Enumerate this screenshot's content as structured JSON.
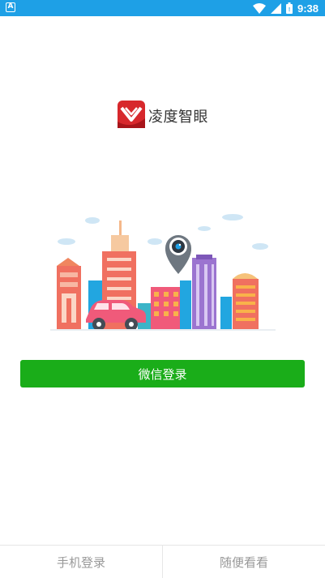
{
  "status_bar": {
    "time": "9:38",
    "app_icon_glyph": "A",
    "icons": [
      "wifi-icon",
      "signal-icon",
      "battery-icon"
    ]
  },
  "header": {
    "app_name": "凌度智眼"
  },
  "login": {
    "wechat_label": "微信登录"
  },
  "bottom_bar": {
    "phone_login_label": "手机登录",
    "browse_label": "随便看看"
  },
  "colors": {
    "status_bar": "#1ea0e6",
    "wechat_button": "#1aad19",
    "logo_red": "#d7282c"
  }
}
